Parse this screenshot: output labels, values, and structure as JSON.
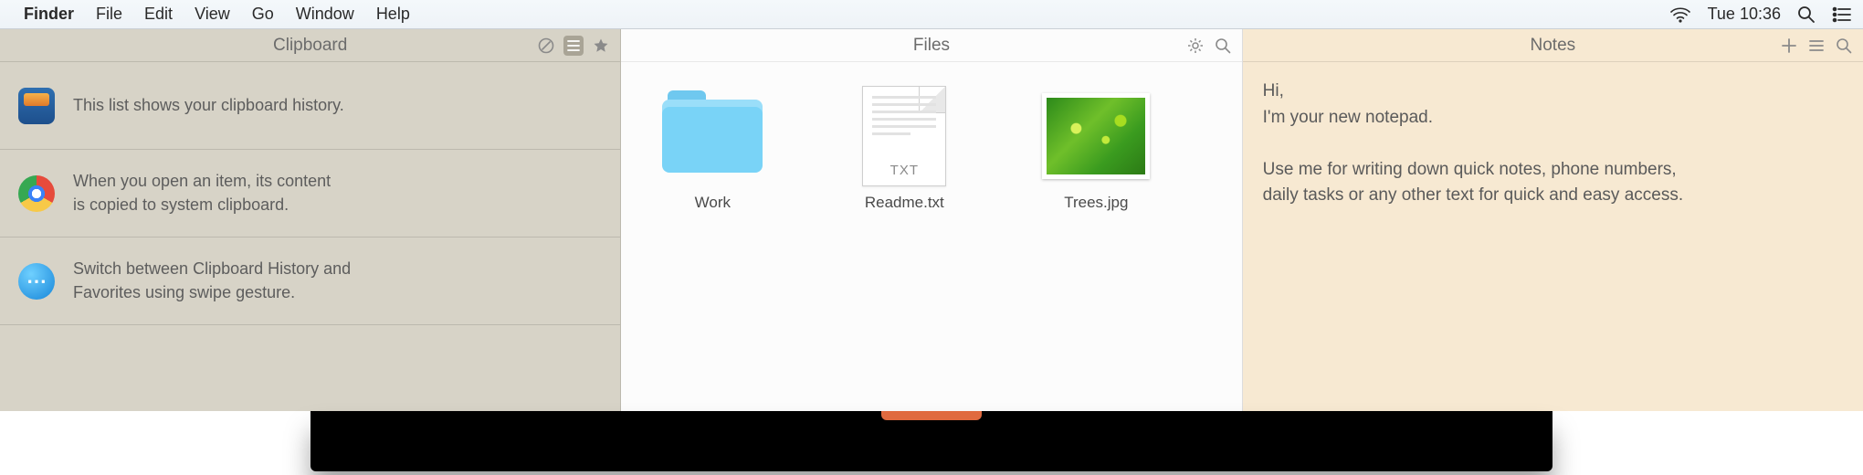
{
  "menubar": {
    "app": "Finder",
    "items": [
      "File",
      "Edit",
      "View",
      "Go",
      "Window",
      "Help"
    ],
    "clock": "Tue 10:36"
  },
  "clipboard": {
    "title": "Clipboard",
    "rows": [
      {
        "icon": "pocket",
        "text": "This list shows your clipboard history."
      },
      {
        "icon": "chrome",
        "text": "When you open an item, its content\nis copied to system clipboard."
      },
      {
        "icon": "messages",
        "text": "Switch between Clipboard History and\nFavorites using swipe gesture."
      }
    ]
  },
  "files": {
    "title": "Files",
    "items": [
      {
        "kind": "folder",
        "label": "Work"
      },
      {
        "kind": "txt",
        "label": "Readme.txt",
        "ext": "TXT"
      },
      {
        "kind": "image",
        "label": "Trees.jpg"
      }
    ]
  },
  "notes": {
    "title": "Notes",
    "body": "Hi,\nI'm your new notepad.\n\nUse me for writing down quick notes, phone numbers,\ndaily tasks or any other text for quick and easy access."
  }
}
